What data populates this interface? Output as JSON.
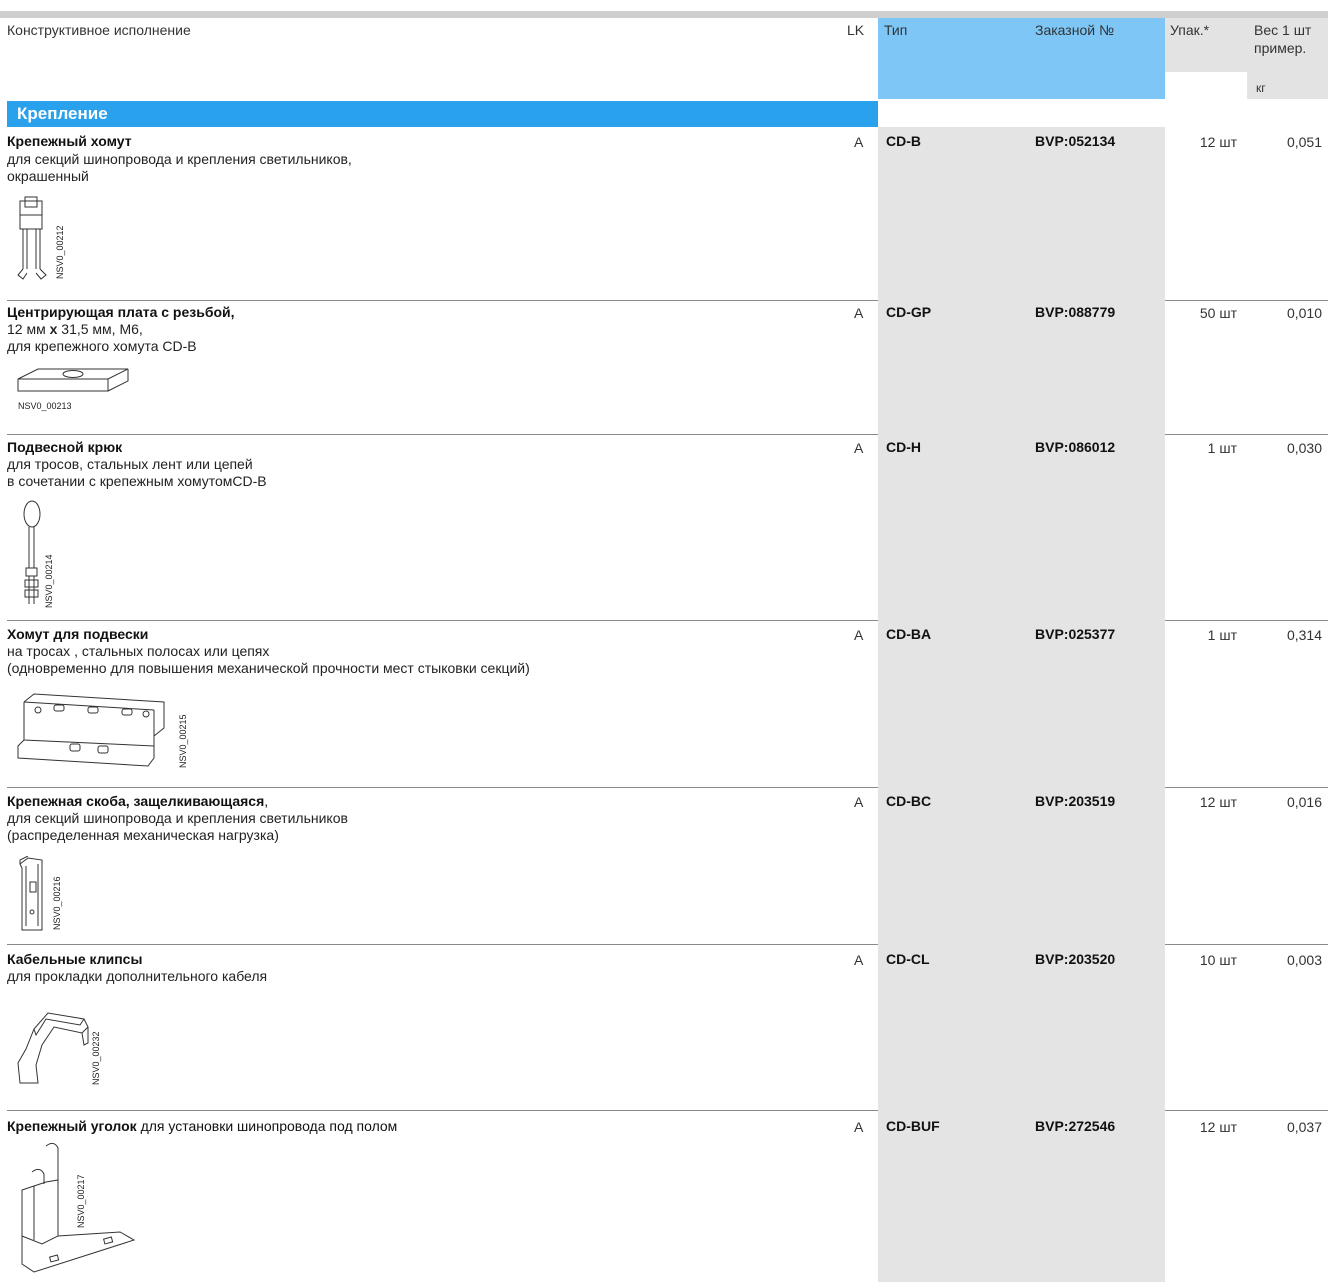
{
  "header": {
    "design": "Конструктивное исполнение",
    "lk": "LK",
    "type": "Тип",
    "order_no": "Заказной №",
    "pack": "Упак.*",
    "weight_line1": "Вес 1 шт",
    "weight_line2": "пример.",
    "weight_unit": "кг"
  },
  "section": {
    "title": "Крепление"
  },
  "rows": [
    {
      "title": "Крепежный хомут",
      "desc": [
        "для секций шинопровода и крепления светильников,",
        "окрашенный"
      ],
      "lk": "A",
      "type": "CD-B",
      "order": "BVP:052134",
      "pack": "12 шт",
      "weight": "0,051",
      "image_code": "NSV0_00212"
    },
    {
      "title": "Центрирующая плата с резьбой,",
      "desc_a": "12 мм",
      "desc_x": "x",
      "desc_b": "31,5 мм, M6,",
      "desc_line2": "для крепежного хомута CD-B",
      "lk": "A",
      "type": "CD-GP",
      "order": "BVP:088779",
      "pack": "50 шт",
      "weight": "0,010",
      "image_code": "NSV0_00213"
    },
    {
      "title": "Подвесной крюк",
      "desc": [
        "для тросов, стальных лент или цепей",
        "в сочетании с крепежным хомутомCD-B"
      ],
      "lk": "A",
      "type": "CD-H",
      "order": "BVP:086012",
      "pack": "1 шт",
      "weight": "0,030",
      "image_code": "NSV0_00214"
    },
    {
      "title": "Хомут для подвески",
      "desc": [
        "на тросах , стальных полосах или цепях",
        "(одновременно для повышения механической прочности мест стыковки секций)"
      ],
      "lk": "A",
      "type": "CD-BA",
      "order": "BVP:025377",
      "pack": "1 шт",
      "weight": "0,314",
      "image_code": "NSV0_00215"
    },
    {
      "title": "Крепежная скоба, защелкивающаяся",
      "title_suffix": ",",
      "desc": [
        "для секций шинопровода и крепления светильников",
        "(распределенная механическая нагрузка)"
      ],
      "lk": "A",
      "type": "CD-BC",
      "order": "BVP:203519",
      "pack": "12 шт",
      "weight": "0,016",
      "image_code": "NSV0_00216"
    },
    {
      "title": "Кабельные клипсы",
      "desc": [
        "для прокладки дополнительного кабеля"
      ],
      "lk": "A",
      "type": "CD-CL",
      "order": "BVP:203520",
      "pack": "10 шт",
      "weight": "0,003",
      "image_code": "NSV0_00232"
    },
    {
      "title": "Крепежный уголок",
      "title_suffix": " для установки шинопровода под полом",
      "lk": "A",
      "type": "CD-BUF",
      "order": "BVP:272546",
      "pack": "12 шт",
      "weight": "0,037",
      "image_code": "NSV0_00217"
    }
  ]
}
